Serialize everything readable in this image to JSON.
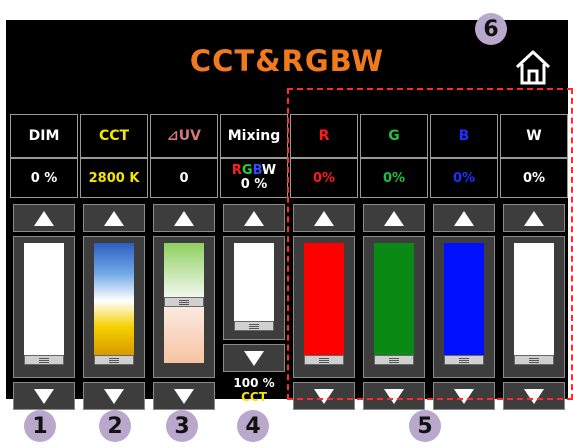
{
  "title": "CCT&RGBW",
  "columns": [
    {
      "key": "dim",
      "label": "DIM",
      "label_color": "#ffffff",
      "value": "0 %",
      "value_color": "#ffffff",
      "level": 0.0
    },
    {
      "key": "cct",
      "label": "CCT",
      "label_color": "#f5e400",
      "value": "2800 K",
      "value_color": "#f5e400",
      "level": 0.0
    },
    {
      "key": "uv",
      "label": "⊿UV",
      "label_color": "#d47a7a",
      "value": "0",
      "value_color": "#ffffff",
      "level": 0.5
    },
    {
      "key": "mixing",
      "label": "Mixing",
      "label_color": "#ffffff",
      "mix_letters": [
        "R",
        "G",
        "B",
        "W"
      ],
      "mix_colors": [
        "#ff2020",
        "#20d040",
        "#3050ff",
        "#ffffff"
      ],
      "value": "0 %",
      "value_color": "#ffffff",
      "level": 0.0,
      "bottom_value": "100 %",
      "bottom_label": "CCT",
      "bottom_label_color": "#f5e400"
    },
    {
      "key": "r",
      "label": "R",
      "label_color": "#ff1a1a",
      "value": "0%",
      "value_color": "#ff1a1a",
      "level": 0.0
    },
    {
      "key": "g",
      "label": "G",
      "label_color": "#20c040",
      "value": "0%",
      "value_color": "#20c040",
      "level": 0.0
    },
    {
      "key": "b",
      "label": "B",
      "label_color": "#2030ff",
      "value": "0%",
      "value_color": "#2030ff",
      "level": 0.0
    },
    {
      "key": "w",
      "label": "W",
      "label_color": "#ffffff",
      "value": "0%",
      "value_color": "#ffffff",
      "level": 0.0
    }
  ],
  "badges": [
    "1",
    "2",
    "3",
    "4",
    "5",
    "6"
  ],
  "colors": {
    "title": "#f07a1c",
    "highlight": "#ff2a2a",
    "badge": "#b9a8cc"
  }
}
